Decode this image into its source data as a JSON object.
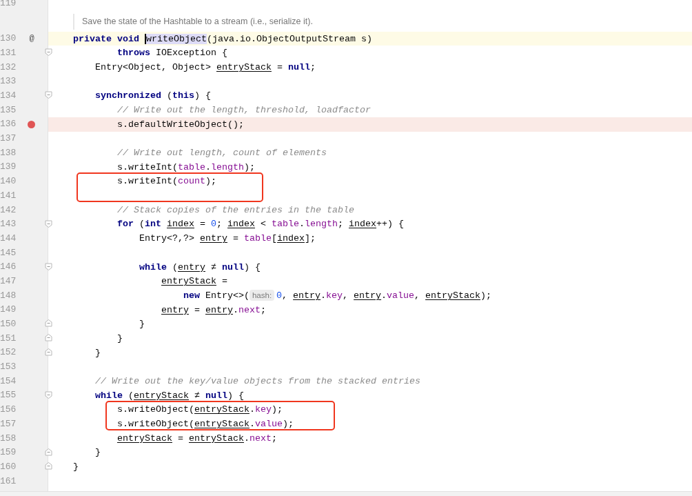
{
  "lines": [
    {
      "kind": "code",
      "number": "119",
      "fold_start": false,
      "fold_end": false,
      "current_line": false,
      "breakpoint": false,
      "boxed": false
    },
    {
      "kind": "doc",
      "text": "Save the state of the Hashtable to a stream (i.e., serialize it)."
    },
    {
      "kind": "code",
      "number": "130",
      "mark": "@",
      "fold_start": false,
      "fold_end": false,
      "current_line": true,
      "breakpoint": false,
      "boxed": false,
      "tokens": [
        {
          "text": "private void ",
          "kind": "keyword"
        },
        {
          "text": "writeObject",
          "kind": "usage"
        },
        {
          "text": "(java.io.ObjectOutputStream s)",
          "kind": "plain"
        }
      ]
    },
    {
      "kind": "code",
      "number": "131",
      "fold_start": true,
      "fold_end": false,
      "current_line": false,
      "breakpoint": false,
      "boxed": false,
      "tokens": [
        {
          "text": "        throws",
          "kind": "keyword"
        },
        {
          "text": " IOException {",
          "kind": "plain"
        }
      ]
    },
    {
      "kind": "code",
      "number": "132",
      "fold_start": false,
      "fold_end": false,
      "current_line": false,
      "breakpoint": false,
      "boxed": false,
      "tokens": [
        {
          "text": "    Entry<Object, Object> ",
          "kind": "plain"
        },
        {
          "text": "entryStack",
          "kind": "variable"
        },
        {
          "text": " = ",
          "kind": "plain"
        },
        {
          "text": "null",
          "kind": "keyword"
        },
        {
          "text": ";",
          "kind": "plain"
        }
      ]
    },
    {
      "kind": "code",
      "number": "133",
      "fold_start": false,
      "fold_end": false,
      "current_line": false,
      "breakpoint": false,
      "boxed": false
    },
    {
      "kind": "code",
      "number": "134",
      "fold_start": true,
      "fold_end": false,
      "current_line": false,
      "breakpoint": false,
      "boxed": false,
      "tokens": [
        {
          "text": "    synchronized",
          "kind": "keyword"
        },
        {
          "text": " (",
          "kind": "plain"
        },
        {
          "text": "this",
          "kind": "keyword"
        },
        {
          "text": ") {",
          "kind": "plain"
        }
      ]
    },
    {
      "kind": "code",
      "number": "135",
      "fold_start": false,
      "fold_end": false,
      "current_line": false,
      "breakpoint": false,
      "boxed": false,
      "tokens": [
        {
          "text": "        // Write out the length, threshold, loadfactor",
          "kind": "comment"
        }
      ]
    },
    {
      "kind": "code",
      "number": "136",
      "fold_start": false,
      "fold_end": false,
      "current_line": false,
      "breakpoint": true,
      "boxed": false,
      "tokens": [
        {
          "text": "        s.defaultWriteObject();",
          "kind": "plain"
        }
      ]
    },
    {
      "kind": "code",
      "number": "137",
      "fold_start": false,
      "fold_end": false,
      "current_line": false,
      "breakpoint": false,
      "boxed": false
    },
    {
      "kind": "code",
      "number": "138",
      "fold_start": false,
      "fold_end": false,
      "current_line": false,
      "breakpoint": false,
      "boxed": false,
      "tokens": [
        {
          "text": "        // Write out length, count of elements",
          "kind": "comment"
        }
      ]
    },
    {
      "kind": "code",
      "number": "139",
      "fold_start": false,
      "fold_end": false,
      "current_line": false,
      "breakpoint": false,
      "boxed": false,
      "tokens": [
        {
          "text": "        s.writeInt(",
          "kind": "plain"
        },
        {
          "text": "table",
          "kind": "field"
        },
        {
          "text": ".",
          "kind": "plain"
        },
        {
          "text": "length",
          "kind": "field"
        },
        {
          "text": ");",
          "kind": "plain"
        }
      ]
    },
    {
      "kind": "code",
      "number": "140",
      "fold_start": false,
      "fold_end": false,
      "current_line": false,
      "breakpoint": false,
      "boxed": true,
      "tokens": [
        {
          "text": "        s.writeInt(",
          "kind": "plain"
        },
        {
          "text": "count",
          "kind": "field"
        },
        {
          "text": ");",
          "kind": "plain"
        }
      ]
    },
    {
      "kind": "code",
      "number": "141",
      "fold_start": false,
      "fold_end": false,
      "current_line": false,
      "breakpoint": false,
      "boxed": true
    },
    {
      "kind": "code",
      "number": "142",
      "fold_start": false,
      "fold_end": false,
      "current_line": false,
      "breakpoint": false,
      "boxed": false,
      "tokens": [
        {
          "text": "        // Stack copies of the entries in the table",
          "kind": "comment"
        }
      ]
    },
    {
      "kind": "code",
      "number": "143",
      "fold_start": true,
      "fold_end": false,
      "current_line": false,
      "breakpoint": false,
      "boxed": false,
      "tokens": [
        {
          "text": "        for",
          "kind": "keyword"
        },
        {
          "text": " (",
          "kind": "plain"
        },
        {
          "text": "int ",
          "kind": "keyword"
        },
        {
          "text": "index",
          "kind": "variable"
        },
        {
          "text": " = ",
          "kind": "plain"
        },
        {
          "text": "0",
          "kind": "number"
        },
        {
          "text": "; ",
          "kind": "plain"
        },
        {
          "text": "index",
          "kind": "variable"
        },
        {
          "text": " < ",
          "kind": "plain"
        },
        {
          "text": "table",
          "kind": "field"
        },
        {
          "text": ".",
          "kind": "plain"
        },
        {
          "text": "length",
          "kind": "field"
        },
        {
          "text": "; ",
          "kind": "plain"
        },
        {
          "text": "index",
          "kind": "variable"
        },
        {
          "text": "++) {",
          "kind": "plain"
        }
      ]
    },
    {
      "kind": "code",
      "number": "144",
      "fold_start": false,
      "fold_end": false,
      "current_line": false,
      "breakpoint": false,
      "boxed": false,
      "tokens": [
        {
          "text": "            Entry<?,?> ",
          "kind": "plain"
        },
        {
          "text": "entry",
          "kind": "variable"
        },
        {
          "text": " = ",
          "kind": "plain"
        },
        {
          "text": "table",
          "kind": "field"
        },
        {
          "text": "[",
          "kind": "plain"
        },
        {
          "text": "index",
          "kind": "variable"
        },
        {
          "text": "];",
          "kind": "plain"
        }
      ]
    },
    {
      "kind": "code",
      "number": "145",
      "fold_start": false,
      "fold_end": false,
      "current_line": false,
      "breakpoint": false,
      "boxed": false
    },
    {
      "kind": "code",
      "number": "146",
      "fold_start": true,
      "fold_end": false,
      "current_line": false,
      "breakpoint": false,
      "boxed": false,
      "tokens": [
        {
          "text": "            while",
          "kind": "keyword"
        },
        {
          "text": " (",
          "kind": "plain"
        },
        {
          "text": "entry",
          "kind": "variable"
        },
        {
          "text": " ≠ ",
          "kind": "plain"
        },
        {
          "text": "null",
          "kind": "keyword"
        },
        {
          "text": ") {",
          "kind": "plain"
        }
      ]
    },
    {
      "kind": "code",
      "number": "147",
      "fold_start": false,
      "fold_end": false,
      "current_line": false,
      "breakpoint": false,
      "boxed": false,
      "tokens": [
        {
          "text": "                entryStack",
          "kind": "variable"
        },
        {
          "text": " =",
          "kind": "plain"
        }
      ]
    },
    {
      "kind": "code",
      "number": "148",
      "fold_start": false,
      "fold_end": false,
      "current_line": false,
      "breakpoint": false,
      "boxed": false,
      "tokens": [
        {
          "text": "                    new",
          "kind": "keyword"
        },
        {
          "text": " Entry<>(",
          "kind": "plain"
        },
        {
          "text": "hash:",
          "kind": "hint"
        },
        {
          "text": "0",
          "kind": "number"
        },
        {
          "text": ", ",
          "kind": "plain"
        },
        {
          "text": "entry",
          "kind": "variable"
        },
        {
          "text": ".",
          "kind": "plain"
        },
        {
          "text": "key",
          "kind": "field"
        },
        {
          "text": ", ",
          "kind": "plain"
        },
        {
          "text": "entry",
          "kind": "variable"
        },
        {
          "text": ".",
          "kind": "plain"
        },
        {
          "text": "value",
          "kind": "field"
        },
        {
          "text": ", ",
          "kind": "plain"
        },
        {
          "text": "entryStack",
          "kind": "variable"
        },
        {
          "text": ");",
          "kind": "plain"
        }
      ]
    },
    {
      "kind": "code",
      "number": "149",
      "fold_start": false,
      "fold_end": false,
      "current_line": false,
      "breakpoint": false,
      "boxed": false,
      "tokens": [
        {
          "text": "                entry",
          "kind": "variable"
        },
        {
          "text": " = ",
          "kind": "plain"
        },
        {
          "text": "entry",
          "kind": "variable"
        },
        {
          "text": ".",
          "kind": "plain"
        },
        {
          "text": "next",
          "kind": "field"
        },
        {
          "text": ";",
          "kind": "plain"
        }
      ]
    },
    {
      "kind": "code",
      "number": "150",
      "fold_start": false,
      "fold_end": true,
      "current_line": false,
      "breakpoint": false,
      "boxed": false,
      "tokens": [
        {
          "text": "            }",
          "kind": "plain"
        }
      ]
    },
    {
      "kind": "code",
      "number": "151",
      "fold_start": false,
      "fold_end": true,
      "current_line": false,
      "breakpoint": false,
      "boxed": false,
      "tokens": [
        {
          "text": "        }",
          "kind": "plain"
        }
      ]
    },
    {
      "kind": "code",
      "number": "152",
      "fold_start": false,
      "fold_end": true,
      "current_line": false,
      "breakpoint": false,
      "boxed": false,
      "tokens": [
        {
          "text": "    }",
          "kind": "plain"
        }
      ]
    },
    {
      "kind": "code",
      "number": "153",
      "fold_start": false,
      "fold_end": false,
      "current_line": false,
      "breakpoint": false,
      "boxed": false
    },
    {
      "kind": "code",
      "number": "154",
      "fold_start": false,
      "fold_end": false,
      "current_line": false,
      "breakpoint": false,
      "boxed": false,
      "tokens": [
        {
          "text": "    // Write out the key/value objects from the stacked entries",
          "kind": "comment"
        }
      ]
    },
    {
      "kind": "code",
      "number": "155",
      "fold_start": true,
      "fold_end": false,
      "current_line": false,
      "breakpoint": false,
      "boxed": false,
      "tokens": [
        {
          "text": "    while",
          "kind": "keyword"
        },
        {
          "text": " (",
          "kind": "plain"
        },
        {
          "text": "entryStack",
          "kind": "variable"
        },
        {
          "text": " ≠ ",
          "kind": "plain"
        },
        {
          "text": "null",
          "kind": "keyword"
        },
        {
          "text": ") {",
          "kind": "plain"
        }
      ]
    },
    {
      "kind": "code",
      "number": "156",
      "fold_start": false,
      "fold_end": false,
      "current_line": false,
      "breakpoint": false,
      "boxed": true,
      "tokens": [
        {
          "text": "        s.writeObject(",
          "kind": "plain"
        },
        {
          "text": "entryStack",
          "kind": "variable"
        },
        {
          "text": ".",
          "kind": "plain"
        },
        {
          "text": "key",
          "kind": "field"
        },
        {
          "text": ");",
          "kind": "plain"
        }
      ]
    },
    {
      "kind": "code",
      "number": "157",
      "fold_start": false,
      "fold_end": false,
      "current_line": false,
      "breakpoint": false,
      "boxed": true,
      "tokens": [
        {
          "text": "        s.writeObject(",
          "kind": "plain"
        },
        {
          "text": "entryStack",
          "kind": "variable"
        },
        {
          "text": ".",
          "kind": "plain"
        },
        {
          "text": "value",
          "kind": "field"
        },
        {
          "text": ");",
          "kind": "plain"
        }
      ]
    },
    {
      "kind": "code",
      "number": "158",
      "fold_start": false,
      "fold_end": false,
      "current_line": false,
      "breakpoint": false,
      "boxed": false,
      "tokens": [
        {
          "text": "        entryStack",
          "kind": "variable"
        },
        {
          "text": " = ",
          "kind": "plain"
        },
        {
          "text": "entryStack",
          "kind": "variable"
        },
        {
          "text": ".",
          "kind": "plain"
        },
        {
          "text": "next",
          "kind": "field"
        },
        {
          "text": ";",
          "kind": "plain"
        }
      ]
    },
    {
      "kind": "code",
      "number": "159",
      "fold_start": false,
      "fold_end": true,
      "current_line": false,
      "breakpoint": false,
      "boxed": false,
      "tokens": [
        {
          "text": "    }",
          "kind": "plain"
        }
      ]
    },
    {
      "kind": "code",
      "number": "160",
      "fold_start": false,
      "fold_end": true,
      "current_line": false,
      "breakpoint": false,
      "boxed": false,
      "tokens": [
        {
          "text": "}",
          "kind": "plain"
        }
      ]
    },
    {
      "kind": "code",
      "number": "161",
      "fold_start": false,
      "fold_end": false,
      "current_line": false,
      "breakpoint": false,
      "boxed": false
    }
  ]
}
